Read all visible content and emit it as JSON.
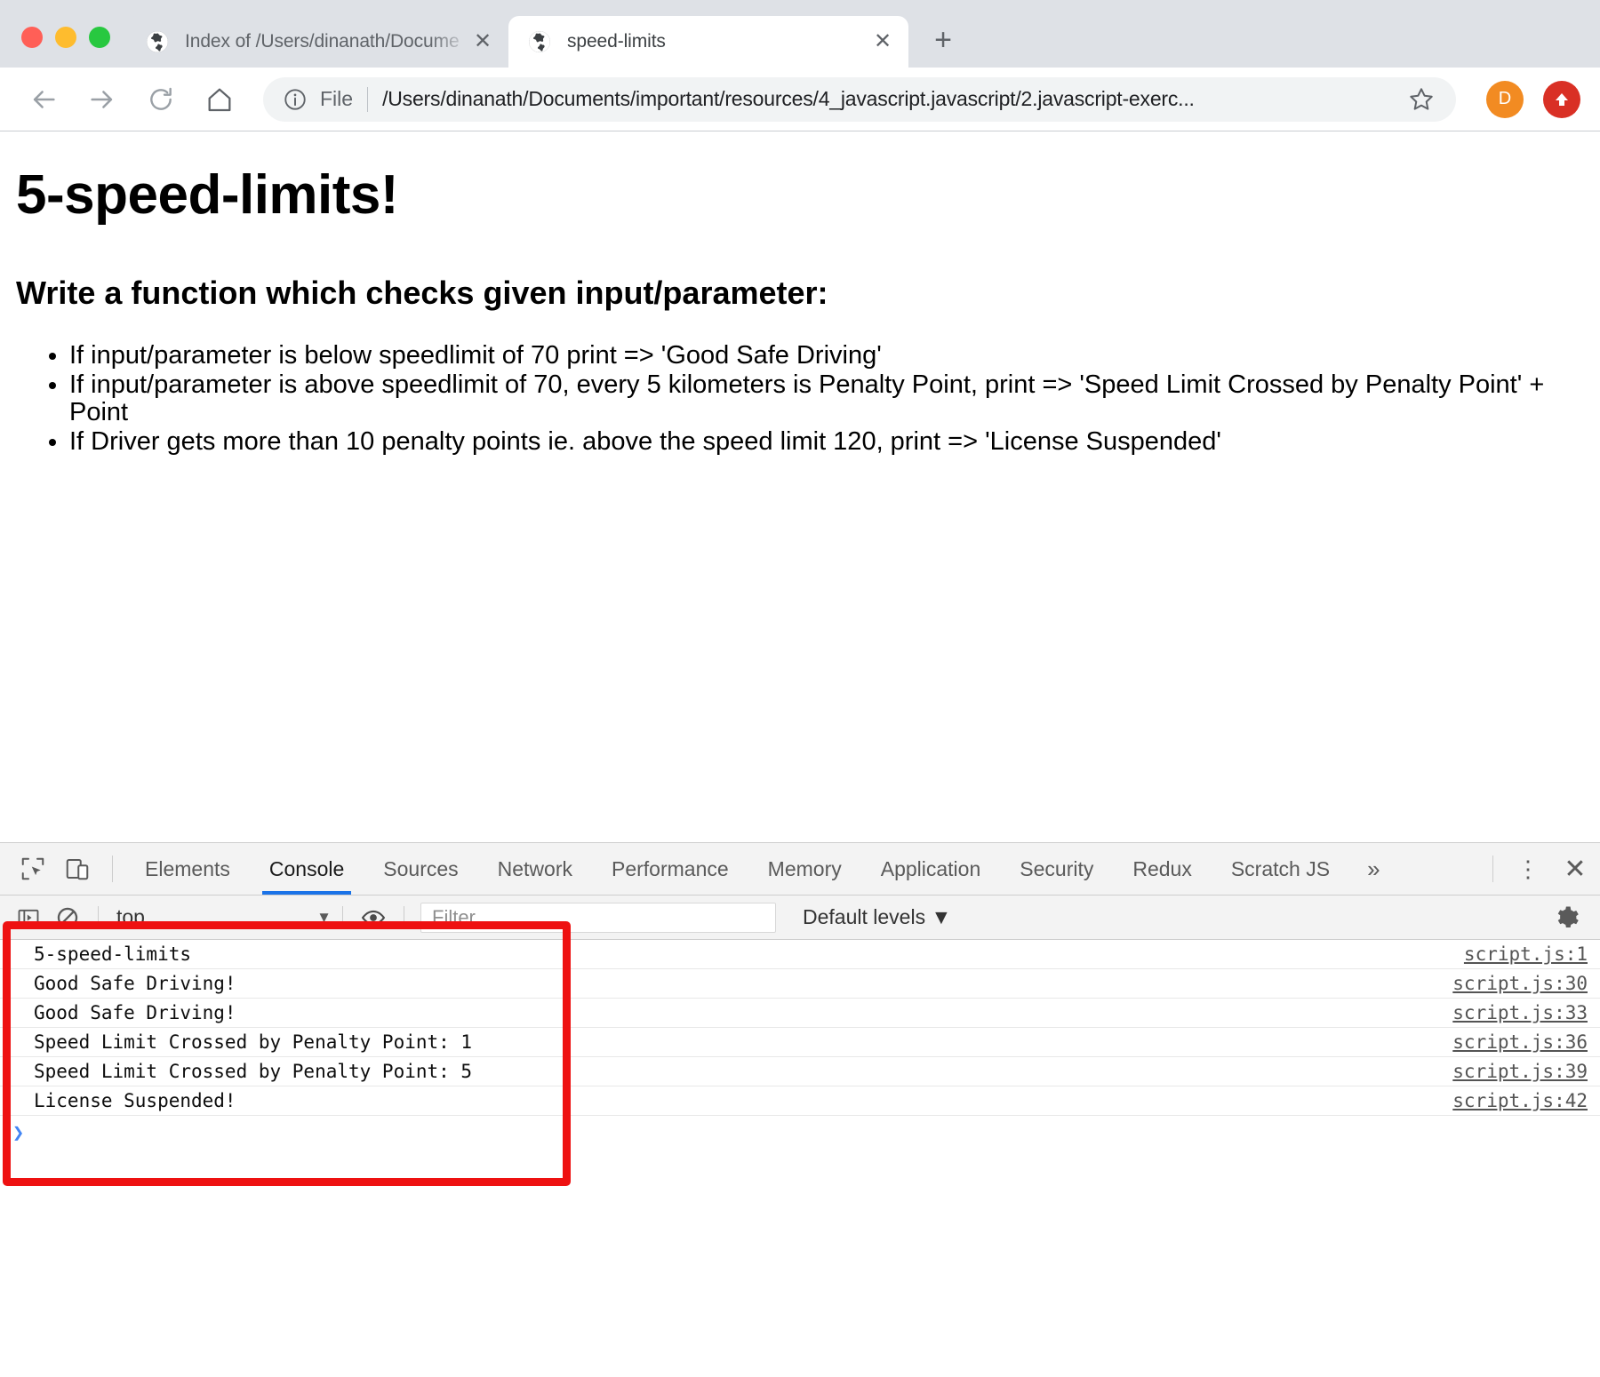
{
  "browser": {
    "window_controls": [
      "close",
      "minimize",
      "maximize"
    ],
    "tabs": [
      {
        "title": "Index of /Users/dinanath/Docume",
        "favicon": "globe-icon",
        "active": false
      },
      {
        "title": "speed-limits",
        "favicon": "globe-icon",
        "active": true
      }
    ],
    "new_tab_label": "+",
    "close_tab_label": "✕",
    "nav": {
      "back": "←",
      "forward": "→",
      "reload": "⟳",
      "home": "⌂"
    },
    "omnibox": {
      "info_icon": "info-circle-icon",
      "scheme": "File",
      "url": "/Users/dinanath/Documents/important/resources/4_javascript.javascript/2.javascript-exerc...",
      "star_icon": "star-outline-icon"
    },
    "profile_initial": "D",
    "update_icon": "up-arrow-icon",
    "colors": {
      "avatar": "#f28b22",
      "update_badge": "#d93025",
      "chrome_bg": "#dee1e6"
    }
  },
  "page": {
    "title": "5-speed-limits!",
    "subtitle": "Write a function which checks given input/parameter:",
    "bullets": [
      "If input/parameter is below speedlimit of 70 print => 'Good Safe Driving'",
      "If input/parameter is above speedlimit of 70, every 5 kilometers is Penalty Point, print => 'Speed Limit Crossed by Penalty Point' + Point",
      "If Driver gets more than 10 penalty points ie. above the speed limit 120, print => 'License Suspended'"
    ]
  },
  "devtools": {
    "inspect_icon": "inspect-element-icon",
    "device_toolbar_icon": "device-toggle-icon",
    "tabs": [
      {
        "label": "Elements",
        "selected": false
      },
      {
        "label": "Console",
        "selected": true
      },
      {
        "label": "Sources",
        "selected": false
      },
      {
        "label": "Network",
        "selected": false
      },
      {
        "label": "Performance",
        "selected": false
      },
      {
        "label": "Memory",
        "selected": false
      },
      {
        "label": "Application",
        "selected": false
      },
      {
        "label": "Security",
        "selected": false
      },
      {
        "label": "Redux",
        "selected": false
      },
      {
        "label": "Scratch JS",
        "selected": false
      }
    ],
    "more_tabs_label": "»",
    "kebab_label": "⋮",
    "close_label": "✕",
    "selected_tab_underline_color": "#1a73e8",
    "filterbar": {
      "sidebar_toggle_icon": "console-sidebar-icon",
      "clear_console_icon": "clear-console-icon",
      "context_value": "top",
      "context_caret": "▼",
      "eye_icon": "live-expression-eye-icon",
      "filter_placeholder": "Filter",
      "filter_value": "",
      "levels_label": "Default levels",
      "levels_caret": "▼",
      "settings_icon": "gear-icon"
    },
    "console_rows": [
      {
        "message": "5-speed-limits",
        "source": "script.js:1"
      },
      {
        "message": "Good Safe Driving!",
        "source": "script.js:30"
      },
      {
        "message": "Good Safe Driving!",
        "source": "script.js:33"
      },
      {
        "message": "Speed Limit Crossed by Penalty Point: 1",
        "source": "script.js:36"
      },
      {
        "message": "Speed Limit Crossed by Penalty Point: 5",
        "source": "script.js:39"
      },
      {
        "message": "License Suspended!",
        "source": "script.js:42"
      }
    ],
    "prompt_caret": "❯"
  },
  "annotation": {
    "shape": "rectangle",
    "color": "#ee1111",
    "target": "console-output-rows"
  }
}
